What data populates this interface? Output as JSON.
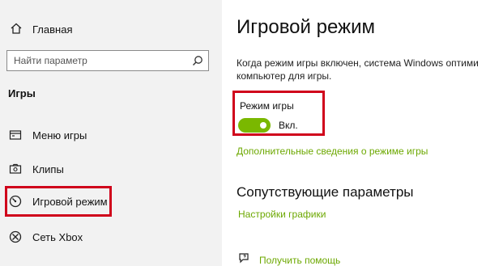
{
  "sidebar": {
    "home_label": "Главная",
    "search_placeholder": "Найти параметр",
    "section_title": "Игры",
    "items": [
      {
        "label": "Меню игры",
        "icon": "game-bar-icon"
      },
      {
        "label": "Клипы",
        "icon": "captures-icon"
      },
      {
        "label": "Игровой режим",
        "icon": "game-mode-icon",
        "selected": true
      },
      {
        "label": "Сеть Xbox",
        "icon": "xbox-icon"
      }
    ]
  },
  "main": {
    "title": "Игровой режим",
    "description_line1": "Когда режим игры включен, система Windows оптими",
    "description_line2": "компьютер для игры.",
    "toggle_label": "Режим игры",
    "toggle_state": "Вкл.",
    "toggle_on": true,
    "more_info_link": "Дополнительные сведения о режиме игры",
    "related_title": "Сопутствующие параметры",
    "graphics_link": "Настройки графики",
    "help_link": "Получить помощь"
  },
  "colors": {
    "accent": "#7ab800",
    "link": "#6ca800",
    "highlight": "#d0021b",
    "sidebar_bg": "#f2f2f2"
  }
}
